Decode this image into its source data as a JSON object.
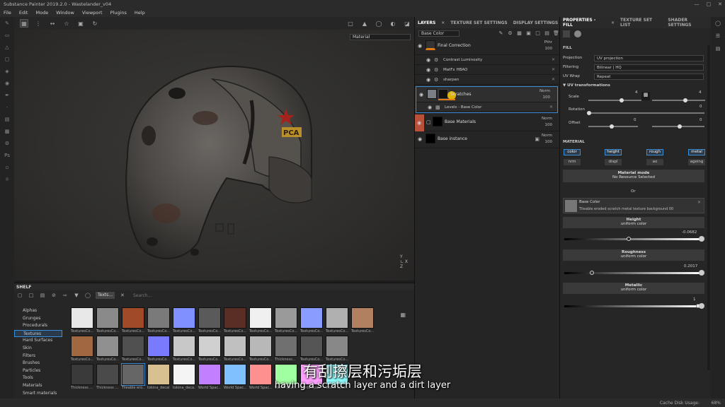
{
  "app": {
    "title": "Substance Painter 2019.2.0 - Wastelander_v04"
  },
  "colors": {
    "accent": "#3b8fd9",
    "highlight": "#f2c200"
  },
  "menu": [
    "File",
    "Edit",
    "Mode",
    "Window",
    "Viewport",
    "Plugins",
    "Help"
  ],
  "viewport": {
    "mode": "Material"
  },
  "helmet": {
    "emblem_text": "РСА"
  },
  "shelf": {
    "title": "SHELF",
    "active_tab": "Texts...",
    "search_placeholder": "Search...",
    "categories": [
      "Alphas",
      "Grunges",
      "Procedurals",
      "Textures",
      "Hard Surfaces",
      "Skin",
      "Filters",
      "Brushes",
      "Particles",
      "Tools",
      "Materials",
      "Smart materials"
    ],
    "selected_category": "Textures",
    "rows": [
      [
        {
          "label": "TexturesCo...",
          "color": "#e8e8e8"
        },
        {
          "label": "TexturesCo...",
          "color": "#8a8a8a"
        },
        {
          "label": "TexturesCo...",
          "color": "#a04a28"
        },
        {
          "label": "TexturesCo...",
          "color": "#7a7a7a"
        },
        {
          "label": "TexturesCo...",
          "color": "#8090ff"
        },
        {
          "label": "TexturesCo...",
          "color": "#5a5a5a"
        },
        {
          "label": "TexturesCo...",
          "color": "#5a2e24"
        },
        {
          "label": "TexturesCo...",
          "color": "#f0f0f0"
        },
        {
          "label": "TexturesCo...",
          "color": "#9a9a9a"
        },
        {
          "label": "TexturesCo...",
          "color": "#8a9cff"
        },
        {
          "label": "TexturesCo...",
          "color": "#b0b0b0"
        },
        {
          "label": "TexturesCo...",
          "color": "#b08060"
        }
      ],
      [
        {
          "label": "TexturesCo...",
          "color": "#a06840"
        },
        {
          "label": "TexturesCo...",
          "color": "#909090"
        },
        {
          "label": "TexturesCo...",
          "color": "#505050"
        },
        {
          "label": "TexturesCo...",
          "color": "#7a7aff"
        },
        {
          "label": "TexturesCo...",
          "color": "#c8c8c8"
        },
        {
          "label": "TexturesCo...",
          "color": "#d0d0d0"
        },
        {
          "label": "TexturesCo...",
          "color": "#c0c0c0"
        },
        {
          "label": "TexturesCo...",
          "color": "#b8b8b8"
        },
        {
          "label": "Thickness...",
          "color": "#707070"
        },
        {
          "label": "TexturesCo...",
          "color": "#555555"
        },
        {
          "label": "TexturesCo...",
          "color": "#888888"
        }
      ],
      [
        {
          "label": "Thickness ...",
          "color": "#3a3a3a"
        },
        {
          "label": "Thickness ...",
          "color": "#4a4a4a"
        },
        {
          "label": "Tileable ero...",
          "color": "#666666"
        },
        {
          "label": "tokina_decal",
          "color": "#d8c090"
        },
        {
          "label": "tokina_deca...",
          "color": "#f4f4f4"
        },
        {
          "label": "World Spac...",
          "color": "#c080ff"
        },
        {
          "label": "World Spac...",
          "color": "#80c0ff"
        },
        {
          "label": "World Spac...",
          "color": "#ff9090"
        },
        {
          "label": "World Spac...",
          "color": "#a0ffa0"
        },
        {
          "label": "World Spac...",
          "color": "#ffa0ff"
        },
        {
          "label": "World Spac...",
          "color": "#90ffff"
        }
      ]
    ]
  },
  "layers_panel": {
    "tabs": [
      "LAYERS",
      "TEXTURE SET SETTINGS",
      "DISPLAY SETTINGS"
    ],
    "channel": "Base Color",
    "layers": [
      {
        "name": "Final Correction",
        "blend": "Pthr",
        "opacity": "100"
      },
      {
        "name": "Scratches",
        "blend": "Norm",
        "opacity": "100"
      },
      {
        "name": "Base Materials",
        "blend": "Norm",
        "opacity": "100"
      },
      {
        "name": "Base instance",
        "blend": "Norm",
        "opacity": "100"
      }
    ],
    "effects": [
      "Contrast Luminosity",
      "MatFx HBAO",
      "sharpen"
    ],
    "scratch_effect": "Levels - Base Color"
  },
  "properties": {
    "tabs": [
      "PROPERTIES - FILL",
      "TEXTURE SET LIST",
      "SHADER SETTINGS"
    ],
    "fill_label": "FILL",
    "projection_label": "Projection",
    "projection_value": "UV projection",
    "filtering_label": "Filtering",
    "filtering_value": "Bilinear | HQ",
    "wrap_label": "UV Wrap",
    "wrap_value": "Repeat",
    "uvt_label": "UV transformations",
    "scale_label": "Scale",
    "scale_value": "4",
    "scale_value2": "4",
    "rotation_label": "Rotation",
    "rotation_value": "0",
    "offset_label": "Offset",
    "offset_value": "0",
    "offset_value2": "0",
    "material_label": "MATERIAL",
    "channels_top": [
      "color",
      "height",
      "rough",
      "metal"
    ],
    "channels_bottom": [
      "nrm",
      "displ",
      "ao",
      "ageing"
    ],
    "material_mode_label": "Material mode",
    "material_mode_value": "No Resource Selected",
    "or_label": "Or",
    "base_color_label": "Base Color",
    "base_color_value": "Tileable eroded scratch metal texture background 00",
    "height_label": "Height",
    "height_sub": "uniform color",
    "height_value": "-0.0682",
    "roughness_label": "Roughness",
    "roughness_sub": "uniform color",
    "roughness_value": "0.2017",
    "metallic_label": "Metallic",
    "metallic_sub": "uniform color",
    "metallic_value": "1"
  },
  "status": {
    "cache": "Cache Disk Usage:",
    "cache_value": "68%"
  },
  "subtitles": {
    "cn": "有刮擦层和污垢层",
    "en": "having a scratch layer and a dirt layer"
  }
}
